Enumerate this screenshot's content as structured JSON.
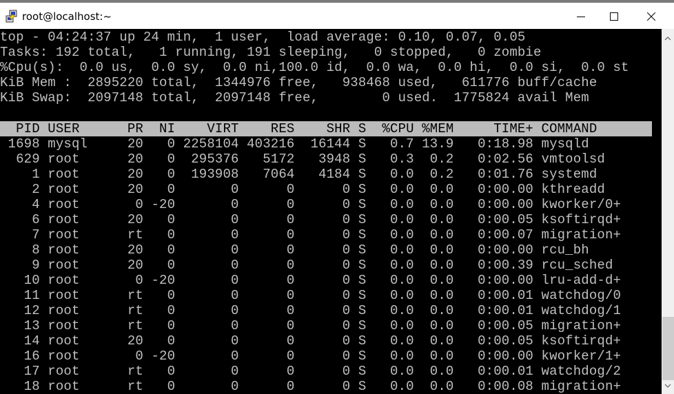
{
  "window": {
    "title": "root@localhost:~",
    "icon": "putty-icon",
    "controls": {
      "minimize": "minimize-icon",
      "maximize": "maximize-icon",
      "close": "close-icon"
    }
  },
  "top": {
    "summary": {
      "line1": "top - 04:24:37 up 24 min,  1 user,  load average: 0.10, 0.07, 0.05",
      "line2": "Tasks: 192 total,   1 running, 191 sleeping,   0 stopped,   0 zombie",
      "line3": "%Cpu(s):  0.0 us,  0.0 sy,  0.0 ni,100.0 id,  0.0 wa,  0.0 hi,  0.0 si,  0.0 st",
      "line4": "KiB Mem :  2895220 total,  1344976 free,   938468 used,   611776 buff/cache",
      "line5": "KiB Swap:  2097148 total,  2097148 free,        0 used.  1775824 avail Mem"
    },
    "uptime": {
      "time": "04:24:37",
      "up": "24 min",
      "users": 1,
      "load_average": [
        0.1,
        0.07,
        0.05
      ]
    },
    "tasks": {
      "total": 192,
      "running": 1,
      "sleeping": 191,
      "stopped": 0,
      "zombie": 0
    },
    "cpu": {
      "us": 0.0,
      "sy": 0.0,
      "ni": 0.0,
      "id": 100.0,
      "wa": 0.0,
      "hi": 0.0,
      "si": 0.0,
      "st": 0.0
    },
    "mem_kib": {
      "total": 2895220,
      "free": 1344976,
      "used": 938468,
      "buff_cache": 611776
    },
    "swap_kib": {
      "total": 2097148,
      "free": 2097148,
      "used": 0,
      "avail_mem": 1775824
    },
    "columns": [
      "PID",
      "USER",
      "PR",
      "NI",
      "VIRT",
      "RES",
      "SHR",
      "S",
      "%CPU",
      "%MEM",
      "TIME+",
      "COMMAND"
    ],
    "processes": [
      {
        "pid": "1698",
        "user": "mysql",
        "pr": "20",
        "ni": "0",
        "virt": "2258104",
        "res": "403216",
        "shr": "16144",
        "s": "S",
        "cpu": "0.7",
        "mem": "13.9",
        "time": "0:18.98",
        "command": "mysqld"
      },
      {
        "pid": "629",
        "user": "root",
        "pr": "20",
        "ni": "0",
        "virt": "295376",
        "res": "5172",
        "shr": "3948",
        "s": "S",
        "cpu": "0.3",
        "mem": "0.2",
        "time": "0:02.56",
        "command": "vmtoolsd"
      },
      {
        "pid": "1",
        "user": "root",
        "pr": "20",
        "ni": "0",
        "virt": "193908",
        "res": "7064",
        "shr": "4184",
        "s": "S",
        "cpu": "0.0",
        "mem": "0.2",
        "time": "0:01.76",
        "command": "systemd"
      },
      {
        "pid": "2",
        "user": "root",
        "pr": "20",
        "ni": "0",
        "virt": "0",
        "res": "0",
        "shr": "0",
        "s": "S",
        "cpu": "0.0",
        "mem": "0.0",
        "time": "0:00.00",
        "command": "kthreadd"
      },
      {
        "pid": "4",
        "user": "root",
        "pr": "0",
        "ni": "-20",
        "virt": "0",
        "res": "0",
        "shr": "0",
        "s": "S",
        "cpu": "0.0",
        "mem": "0.0",
        "time": "0:00.00",
        "command": "kworker/0+"
      },
      {
        "pid": "6",
        "user": "root",
        "pr": "20",
        "ni": "0",
        "virt": "0",
        "res": "0",
        "shr": "0",
        "s": "S",
        "cpu": "0.0",
        "mem": "0.0",
        "time": "0:00.05",
        "command": "ksoftirqd+"
      },
      {
        "pid": "7",
        "user": "root",
        "pr": "rt",
        "ni": "0",
        "virt": "0",
        "res": "0",
        "shr": "0",
        "s": "S",
        "cpu": "0.0",
        "mem": "0.0",
        "time": "0:00.07",
        "command": "migration+"
      },
      {
        "pid": "8",
        "user": "root",
        "pr": "20",
        "ni": "0",
        "virt": "0",
        "res": "0",
        "shr": "0",
        "s": "S",
        "cpu": "0.0",
        "mem": "0.0",
        "time": "0:00.00",
        "command": "rcu_bh"
      },
      {
        "pid": "9",
        "user": "root",
        "pr": "20",
        "ni": "0",
        "virt": "0",
        "res": "0",
        "shr": "0",
        "s": "S",
        "cpu": "0.0",
        "mem": "0.0",
        "time": "0:00.39",
        "command": "rcu_sched"
      },
      {
        "pid": "10",
        "user": "root",
        "pr": "0",
        "ni": "-20",
        "virt": "0",
        "res": "0",
        "shr": "0",
        "s": "S",
        "cpu": "0.0",
        "mem": "0.0",
        "time": "0:00.00",
        "command": "lru-add-d+"
      },
      {
        "pid": "11",
        "user": "root",
        "pr": "rt",
        "ni": "0",
        "virt": "0",
        "res": "0",
        "shr": "0",
        "s": "S",
        "cpu": "0.0",
        "mem": "0.0",
        "time": "0:00.01",
        "command": "watchdog/0"
      },
      {
        "pid": "12",
        "user": "root",
        "pr": "rt",
        "ni": "0",
        "virt": "0",
        "res": "0",
        "shr": "0",
        "s": "S",
        "cpu": "0.0",
        "mem": "0.0",
        "time": "0:00.01",
        "command": "watchdog/1"
      },
      {
        "pid": "13",
        "user": "root",
        "pr": "rt",
        "ni": "0",
        "virt": "0",
        "res": "0",
        "shr": "0",
        "s": "S",
        "cpu": "0.0",
        "mem": "0.0",
        "time": "0:00.05",
        "command": "migration+"
      },
      {
        "pid": "14",
        "user": "root",
        "pr": "20",
        "ni": "0",
        "virt": "0",
        "res": "0",
        "shr": "0",
        "s": "S",
        "cpu": "0.0",
        "mem": "0.0",
        "time": "0:00.05",
        "command": "ksoftirqd+"
      },
      {
        "pid": "16",
        "user": "root",
        "pr": "0",
        "ni": "-20",
        "virt": "0",
        "res": "0",
        "shr": "0",
        "s": "S",
        "cpu": "0.0",
        "mem": "0.0",
        "time": "0:00.00",
        "command": "kworker/1+"
      },
      {
        "pid": "17",
        "user": "root",
        "pr": "rt",
        "ni": "0",
        "virt": "0",
        "res": "0",
        "shr": "0",
        "s": "S",
        "cpu": "0.0",
        "mem": "0.0",
        "time": "0:00.01",
        "command": "watchdog/2"
      },
      {
        "pid": "18",
        "user": "root",
        "pr": "rt",
        "ni": "0",
        "virt": "0",
        "res": "0",
        "shr": "0",
        "s": "S",
        "cpu": "0.0",
        "mem": "0.0",
        "time": "0:00.08",
        "command": "migration+"
      }
    ]
  },
  "scrollbar": {
    "up_icon": "chevron-up-icon",
    "down_icon": "chevron-down-icon",
    "position_fraction": 0.92
  },
  "colors": {
    "terminal_bg": "#000000",
    "terminal_fg": "#c0c0c0",
    "header_bg": "#bbbbbb",
    "header_fg": "#000000",
    "titlebar_bg": "#ffffff"
  }
}
